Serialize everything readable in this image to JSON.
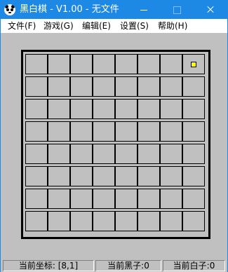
{
  "window": {
    "title": "黑白棋 - V1.00 - 无文件",
    "app_icon": "panda-icon",
    "title_bar_color": "#1e88e5"
  },
  "menu": [
    {
      "label": "文件(F)"
    },
    {
      "label": "游戏(G)"
    },
    {
      "label": "编辑(E)"
    },
    {
      "label": "设置(S)"
    },
    {
      "label": "帮助(H)"
    }
  ],
  "board": {
    "rows": 8,
    "cols": 8,
    "background": "#c0c0c0",
    "cursor_color": "#ffff00",
    "cursor_cell": {
      "col": 8,
      "row": 1
    }
  },
  "status": {
    "coords": "当前坐标: [8,1]",
    "black": "当前黑子:0",
    "white": "当前白子:0"
  }
}
